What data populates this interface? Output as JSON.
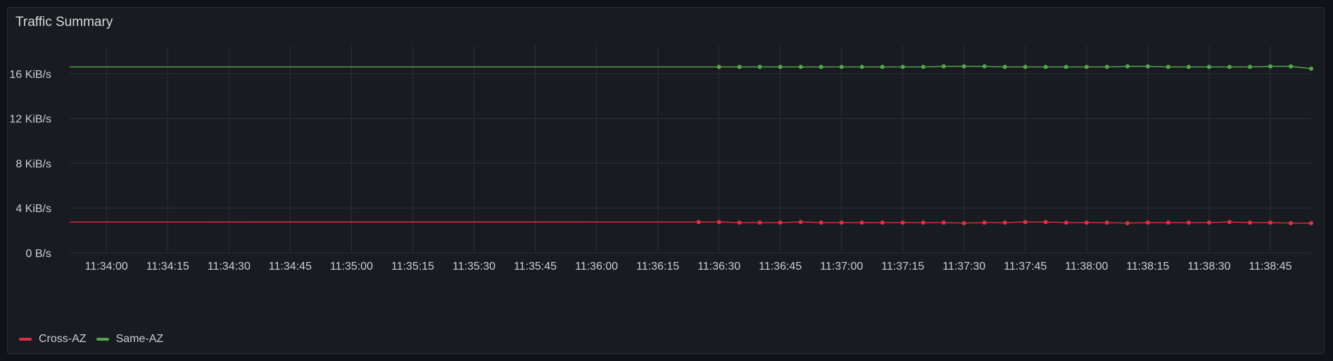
{
  "panel": {
    "title": "Traffic Summary"
  },
  "colors": {
    "background": "#181b1f",
    "grid": "#2c2f35",
    "cross_az": "#e02f44",
    "same_az": "#56a64b"
  },
  "chart_data": {
    "type": "line",
    "title": "Traffic Summary",
    "xlabel": "",
    "ylabel": "",
    "unit": "KiB/s",
    "y_ticks": [
      "0 B/s",
      "4 KiB/s",
      "8 KiB/s",
      "12 KiB/s",
      "16 KiB/s"
    ],
    "y_tick_values": [
      0,
      4,
      8,
      12,
      16
    ],
    "ylim": [
      0,
      18.5
    ],
    "x_ticks": [
      "11:34:00",
      "11:34:15",
      "11:34:30",
      "11:34:45",
      "11:35:00",
      "11:35:15",
      "11:35:30",
      "11:35:45",
      "11:36:00",
      "11:36:15",
      "11:36:30",
      "11:36:45",
      "11:37:00",
      "11:37:15",
      "11:37:30",
      "11:37:45",
      "11:38:00",
      "11:38:15",
      "11:38:30",
      "11:38:45"
    ],
    "x_range_seconds_from_first_tick": [
      -9,
      295
    ],
    "point_interval_seconds": 5,
    "grid": true,
    "legend_position": "bottom-left",
    "series": [
      {
        "name": "Cross-AZ",
        "color": "#e02f44",
        "values": [
          2.75,
          2.75,
          2.7,
          2.7,
          2.7,
          2.75,
          2.7,
          2.7,
          2.7,
          2.7,
          2.7,
          2.7,
          2.7,
          2.65,
          2.7,
          2.7,
          2.75,
          2.75,
          2.7,
          2.7,
          2.7,
          2.65,
          2.7,
          2.7,
          2.7,
          2.7,
          2.75,
          2.7,
          2.7,
          2.65,
          2.65
        ]
      },
      {
        "name": "Same-AZ",
        "color": "#56a64b",
        "values": [
          16.6,
          16.6,
          16.6,
          16.6,
          16.6,
          16.6,
          16.6,
          16.6,
          16.6,
          16.6,
          16.6,
          16.65,
          16.65,
          16.65,
          16.6,
          16.6,
          16.6,
          16.6,
          16.6,
          16.6,
          16.65,
          16.65,
          16.6,
          16.6,
          16.6,
          16.6,
          16.6,
          16.65,
          16.65,
          16.45
        ]
      }
    ]
  },
  "legend": {
    "items": [
      {
        "label": "Cross-AZ",
        "color": "#e02f44"
      },
      {
        "label": "Same-AZ",
        "color": "#56a64b"
      }
    ]
  }
}
